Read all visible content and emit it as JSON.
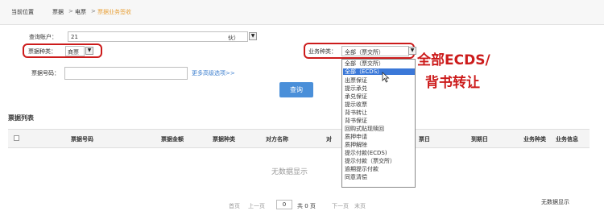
{
  "breadcrumb": {
    "current_position": "当前位置",
    "level1": "票据",
    "level2": "电票",
    "level3": "票据业务签收",
    "separator": ">"
  },
  "form": {
    "query_account_label": "查询账户：",
    "query_account_value": "21",
    "query_account_suffix": "伙）",
    "bill_type_label": "票据种类：",
    "bill_type_value": "商票",
    "bill_no_label": "票据号码：",
    "bill_no_value": "",
    "more_options": "更多高级选项>>",
    "biz_type_label": "业务种类：",
    "biz_type_value": "全部（票交所）",
    "query_button": "查询"
  },
  "dropdown": {
    "options": [
      "全部（票交所）",
      "全部（ECDS）",
      "出票保证",
      "提示承兑",
      "承兑保证",
      "提示收票",
      "背书转让",
      "背书保证",
      "回购式贴现赎回",
      "质押申请",
      "质押解除",
      "提示付款(ECDS)",
      "提示付款（票交所）",
      "逾期提示付款",
      "同意清偿"
    ],
    "selected_index": 1
  },
  "annotation": {
    "line1": "全部ECDS/",
    "line2": "背书转让"
  },
  "table": {
    "section_title": "票据列表",
    "columns": [
      "票据号码",
      "票据金额",
      "票据种类",
      "对方名称",
      "对",
      "票日",
      "到期日",
      "业务种类",
      "业务信息"
    ],
    "empty_text": "无数据显示"
  },
  "pager": {
    "first": "首页",
    "prev": "上一页",
    "current_page": "0",
    "total": "共 0 页",
    "next": "下一页",
    "last": "末页",
    "status": "无数据显示"
  },
  "colors": {
    "highlight_red": "#cc1b1b",
    "button_blue": "#4a8fd9",
    "selection_blue": "#3b78d8",
    "breadcrumb_active": "#e8a13a"
  }
}
